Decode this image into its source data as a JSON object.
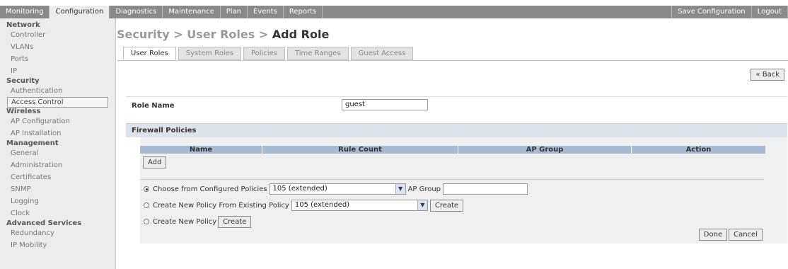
{
  "topnav": {
    "tabs": [
      "Monitoring",
      "Configuration",
      "Diagnostics",
      "Maintenance",
      "Plan",
      "Events",
      "Reports"
    ],
    "right_tabs": [
      "Save Configuration",
      "Logout"
    ]
  },
  "sidebar": {
    "sections": [
      {
        "heading": "Network",
        "items": [
          "Controller",
          "VLANs",
          "Ports",
          "IP"
        ]
      },
      {
        "heading": "Security",
        "items": [
          "Authentication",
          "Access Control"
        ]
      },
      {
        "heading": "Wireless",
        "items": [
          "AP Configuration",
          "AP Installation"
        ]
      },
      {
        "heading": "Management",
        "items": [
          "General",
          "Administration",
          "Certificates",
          "SNMP",
          "Logging",
          "Clock"
        ]
      },
      {
        "heading": "Advanced Services",
        "items": [
          "Redundancy",
          "IP Mobility"
        ]
      }
    ]
  },
  "page": {
    "breadcrumb": "Security > User Roles > ",
    "title": "Add Role",
    "tabs": [
      "User Roles",
      "System Roles",
      "Policies",
      "Time Ranges",
      "Guest Access"
    ],
    "back_label": "« Back"
  },
  "role": {
    "label": "Role Name",
    "value": "guest"
  },
  "firewall": {
    "heading": "Firewall Policies",
    "columns": [
      "Name",
      "Rule Count",
      "AP Group",
      "Action"
    ],
    "add_label": "Add",
    "options": {
      "choose_label": "Choose from Configured Policies",
      "choose_value": "105 (extended)",
      "ap_group_label": "AP Group",
      "ap_group_value": "",
      "existing_label": "Create New Policy From Existing Policy",
      "existing_value": "105 (extended)",
      "new_label": "Create New Policy",
      "create_label": "Create"
    },
    "done_label": "Done",
    "cancel_label": "Cancel"
  }
}
